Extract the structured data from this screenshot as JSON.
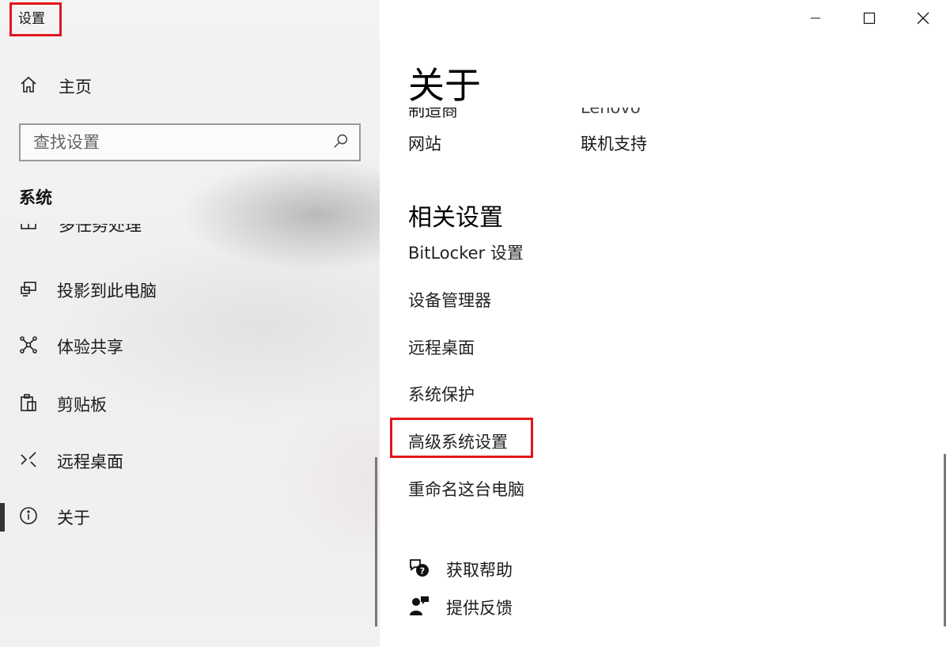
{
  "window": {
    "title": "设置",
    "controls": [
      "minimize-icon",
      "maximize-icon",
      "close-icon"
    ]
  },
  "sidebar": {
    "home_label": "主页",
    "search_placeholder": "查找设置",
    "section_label": "系统",
    "clipped_item_label": "多任务处理",
    "items": [
      {
        "label": "投影到此电脑",
        "icon": "projector-icon"
      },
      {
        "label": "体验共享",
        "icon": "share-network-icon"
      },
      {
        "label": "剪贴板",
        "icon": "clipboard-icon"
      },
      {
        "label": "远程桌面",
        "icon": "remote-desktop-icon"
      },
      {
        "label": "关于",
        "icon": "info-icon",
        "active": true
      }
    ]
  },
  "main": {
    "page_title": "关于",
    "specs": {
      "manufacturer_label": "制造商",
      "manufacturer_value": "Lenovo",
      "website_label": "网站",
      "website_value": "联机支持"
    },
    "related_title": "相关设置",
    "related_links": [
      "BitLocker 设置",
      "设备管理器",
      "远程桌面",
      "系统保护",
      "高级系统设置",
      "重命名这台电脑"
    ],
    "help": {
      "get_help": "获取帮助",
      "feedback": "提供反馈"
    }
  },
  "colors": {
    "highlight": "#e3151a",
    "sidebar_bg": "#f1f1f1",
    "main_bg": "#ffffff"
  }
}
